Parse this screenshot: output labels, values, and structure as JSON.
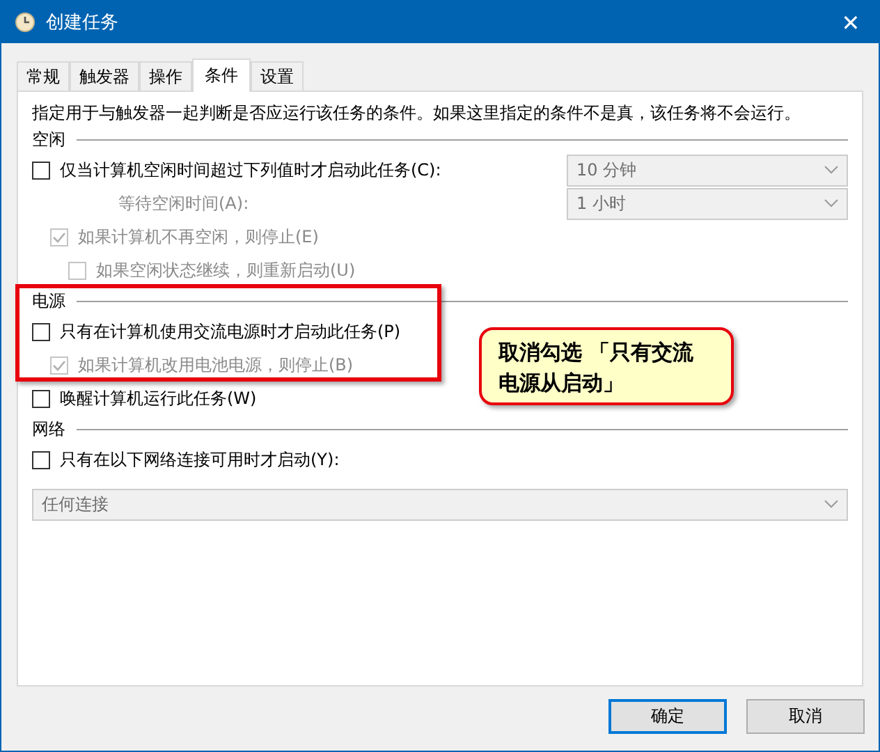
{
  "window": {
    "title": "创建任务",
    "close": "✕"
  },
  "tabs": [
    {
      "label": "常规",
      "selected": false
    },
    {
      "label": "触发器",
      "selected": false
    },
    {
      "label": "操作",
      "selected": false
    },
    {
      "label": "条件",
      "selected": true
    },
    {
      "label": "设置",
      "selected": false
    }
  ],
  "description": "指定用于与触发器一起判断是否应运行该任务的条件。如果这里指定的条件不是真，该任务将不会运行。",
  "sections": [
    {
      "title": "空闲",
      "items": [
        {
          "kind": "checkbox",
          "label": "仅当计算机空闲时间超过下列值时才启动此任务(C):",
          "checked": false,
          "disabled": false,
          "dropdown": {
            "value": "10 分钟",
            "disabled": true
          },
          "children": [
            {
              "kind": "field",
              "label": "等待空闲时间(A):",
              "disabled": true,
              "dropdown": {
                "value": "1 小时",
                "disabled": true
              }
            },
            {
              "kind": "checkbox",
              "label": "如果计算机不再空闲，则停止(E)",
              "checked": true,
              "disabled": true,
              "children": [
                {
                  "kind": "checkbox",
                  "label": "如果空闲状态继续，则重新启动(U)",
                  "checked": false,
                  "disabled": true
                }
              ]
            }
          ]
        }
      ]
    },
    {
      "title": "电源",
      "items": [
        {
          "kind": "checkbox",
          "label": "只有在计算机使用交流电源时才启动此任务(P)",
          "checked": false,
          "disabled": false,
          "children": [
            {
              "kind": "checkbox",
              "label": "如果计算机改用电池电源，则停止(B)",
              "checked": true,
              "disabled": true
            }
          ]
        },
        {
          "kind": "checkbox",
          "label": "唤醒计算机运行此任务(W)",
          "checked": false,
          "disabled": false
        }
      ]
    },
    {
      "title": "网络",
      "items": [
        {
          "kind": "checkbox",
          "label": "只有在以下网络连接可用时才启动(Y):",
          "checked": false,
          "disabled": false
        },
        {
          "kind": "dropdown",
          "value": "任何连接",
          "disabled": true
        }
      ]
    }
  ],
  "callout": "取消勾选 「只有交流电源从启动」",
  "buttons": [
    {
      "label": "确定",
      "default": true
    },
    {
      "label": "取消",
      "default": false
    }
  ]
}
